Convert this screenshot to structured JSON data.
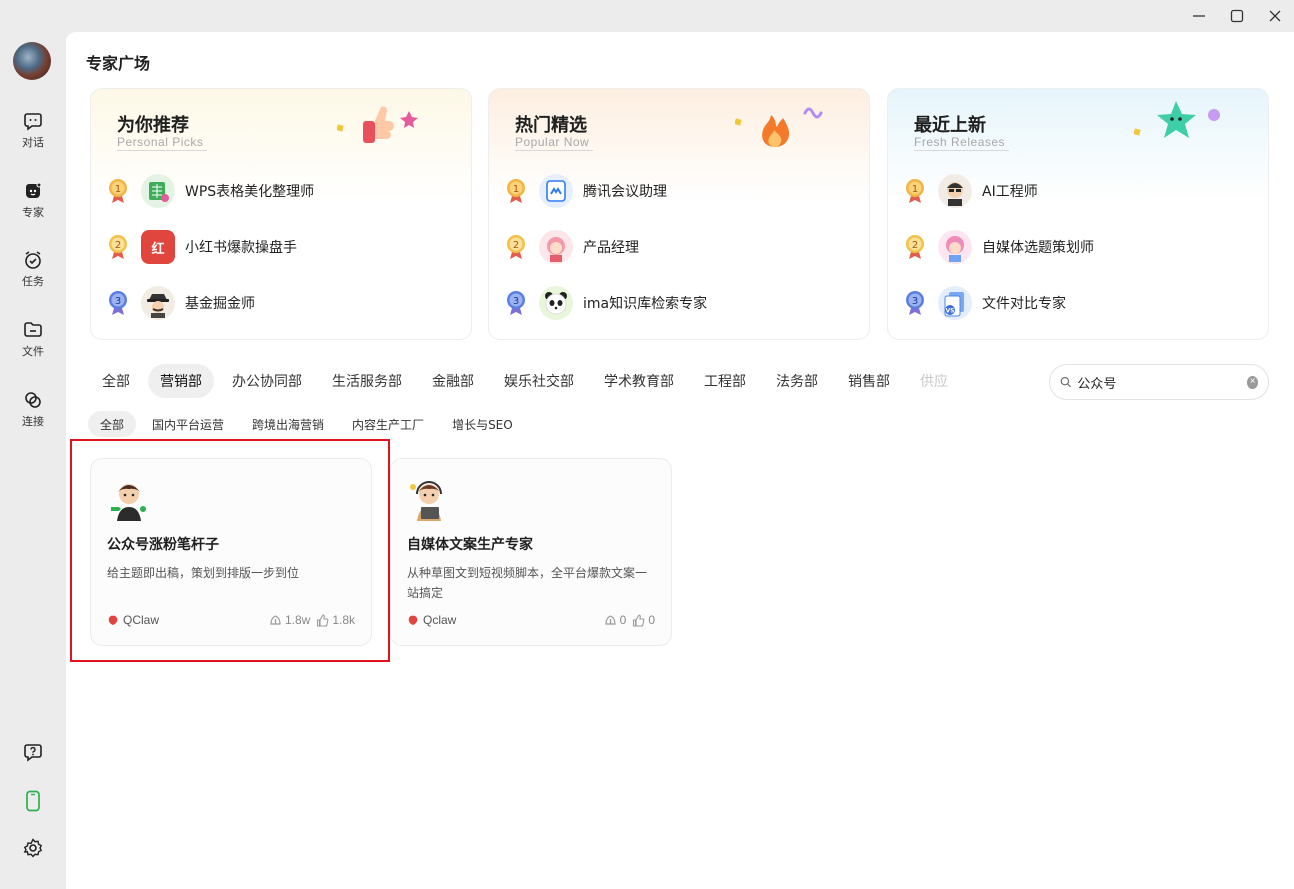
{
  "window": {
    "minimize": "—",
    "maximize": "☐",
    "close": "✕"
  },
  "sidebar": {
    "items": [
      {
        "label": "对话",
        "icon": "chat-icon"
      },
      {
        "label": "专家",
        "icon": "expert-icon"
      },
      {
        "label": "任务",
        "icon": "alarm-icon"
      },
      {
        "label": "文件",
        "icon": "folder-icon"
      },
      {
        "label": "连接",
        "icon": "link-icon"
      }
    ],
    "bottom": [
      "help-icon",
      "phone-icon",
      "gear-icon"
    ]
  },
  "page": {
    "title": "专家广场"
  },
  "featured": [
    {
      "title": "为你推荐",
      "subtitle": "Personal Picks",
      "items": [
        {
          "rank": "1",
          "name": "WPS表格美化整理师"
        },
        {
          "rank": "2",
          "name": "小红书爆款操盘手",
          "badge": "红"
        },
        {
          "rank": "3",
          "name": "基金掘金师"
        }
      ]
    },
    {
      "title": "热门精选",
      "subtitle": "Popular Now",
      "items": [
        {
          "rank": "1",
          "name": "腾讯会议助理"
        },
        {
          "rank": "2",
          "name": "产品经理"
        },
        {
          "rank": "3",
          "name": "ima知识库检索专家"
        }
      ]
    },
    {
      "title": "最近上新",
      "subtitle": "Fresh Releases",
      "items": [
        {
          "rank": "1",
          "name": "AI工程师"
        },
        {
          "rank": "2",
          "name": "自媒体选题策划师"
        },
        {
          "rank": "3",
          "name": "文件对比专家",
          "badge": "VS"
        }
      ]
    }
  ],
  "categories": [
    "全部",
    "营销部",
    "办公协同部",
    "生活服务部",
    "金融部",
    "娱乐社交部",
    "学术教育部",
    "工程部",
    "法务部",
    "销售部",
    "供应"
  ],
  "active_category": "营销部",
  "search": {
    "value": "公众号"
  },
  "subcategories": [
    "全部",
    "国内平台运营",
    "跨境出海营销",
    "内容生产工厂",
    "增长与SEO"
  ],
  "experts": [
    {
      "name": "公众号涨粉笔杆子",
      "desc": "给主题即出稿，策划到排版一步到位",
      "author": "QClaw",
      "uses": "1.8w",
      "likes": "1.8k"
    },
    {
      "name": "自媒体文案生产专家",
      "desc": "从种草图文到短视频脚本，全平台爆款文案一站搞定",
      "author": "Qclaw",
      "uses": "0",
      "likes": "0"
    }
  ],
  "colors": {
    "highlight": "#e0141e",
    "accent_green": "#2bb24c"
  }
}
